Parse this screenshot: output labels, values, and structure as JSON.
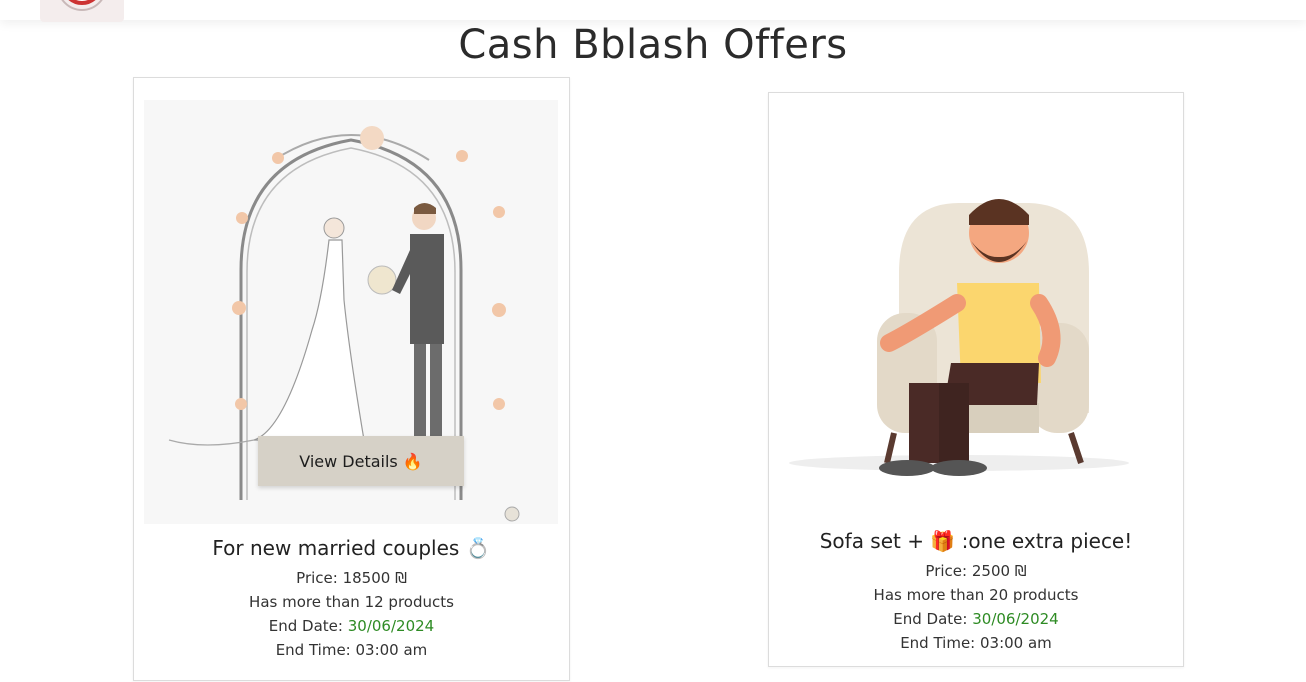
{
  "header": {
    "logo_icon": "logo-icon"
  },
  "page": {
    "title": "Cash Bblash Offers"
  },
  "offers": [
    {
      "image_icon": "wedding-couple-illustration",
      "button_label": "View Details 🔥",
      "title": "For new married couples 💍",
      "price_label": "Price:",
      "price": "18500 ₪",
      "products": "Has more than 12 products",
      "end_date_label": "End Date:",
      "end_date": "30/06/2024",
      "end_time": "End Time: 03:00 am"
    },
    {
      "image_icon": "man-in-armchair-illustration",
      "title": "Sofa set + 🎁 :one extra piece!",
      "price_label": "Price:",
      "price": "2500 ₪",
      "products": "Has more than 20 products",
      "end_date_label": "End Date:",
      "end_date": "30/06/2024",
      "end_time": "End Time: 03:00 am"
    }
  ],
  "colors": {
    "date": "#2e8b24",
    "button_bg": "#d6d1c7"
  }
}
